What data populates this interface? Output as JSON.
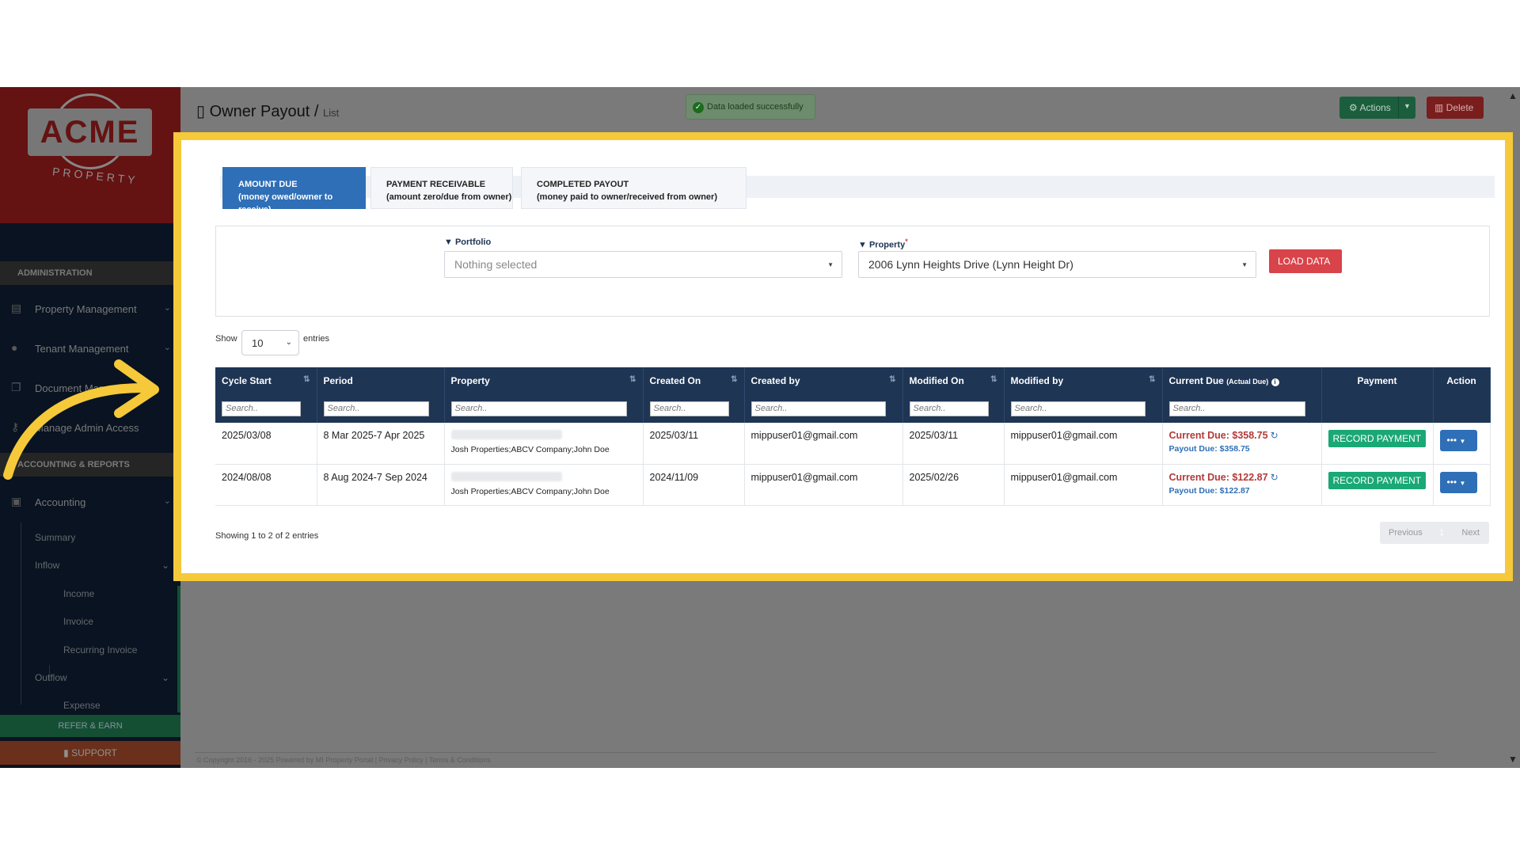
{
  "brand": {
    "logo_text": "ACME",
    "logo_sub": "PROPERTY"
  },
  "sidebar": {
    "sections": {
      "admin": "ADMINISTRATION",
      "accounting": "ACCOUNTING & REPORTS"
    },
    "items": [
      {
        "label": "Property Management",
        "icon": "building-icon"
      },
      {
        "label": "Tenant Management",
        "icon": "users-icon"
      },
      {
        "label": "Document Management",
        "icon": "copy-icon"
      },
      {
        "label": "Manage Admin Access",
        "icon": "key-icon"
      },
      {
        "label": "Accounting",
        "icon": "money-icon"
      }
    ],
    "subitems": {
      "summary": "Summary",
      "inflow": "Inflow",
      "income": "Income",
      "invoice": "Invoice",
      "recurring": "Recurring Invoice",
      "outflow": "Outflow",
      "expense": "Expense"
    },
    "refer": "REFER & EARN",
    "support": "SUPPORT"
  },
  "header": {
    "title": "Owner Payout",
    "separator": "/",
    "crumb": "List",
    "toast": "Data loaded successfully",
    "actions_label": "Actions",
    "delete_label": "Delete"
  },
  "tabs": [
    {
      "title": "AMOUNT DUE",
      "subtitle": "(money owed/owner to receive)",
      "active": true
    },
    {
      "title": "PAYMENT RECEIVABLE",
      "subtitle": "(amount zero/due from owner)",
      "active": false
    },
    {
      "title": "COMPLETED PAYOUT",
      "subtitle": "(money paid to owner/received from owner)",
      "active": false
    }
  ],
  "filters": {
    "portfolio_label": "Portfolio",
    "portfolio_value": "Nothing selected",
    "property_label": "Property",
    "property_required": "*",
    "property_value": "2006 Lynn Heights Drive (Lynn Height Dr)",
    "load_button": "LOAD DATA"
  },
  "entries": {
    "show": "Show",
    "value": "10",
    "suffix": "entries"
  },
  "table": {
    "columns": [
      "Cycle Start",
      "Period",
      "Property",
      "Created On",
      "Created by",
      "Modified On",
      "Modified by",
      "Current Due",
      "Payment",
      "Action"
    ],
    "current_due_note": "(Actual Due)",
    "search_placeholder": "Search..",
    "rows": [
      {
        "cycle_start": "2025/03/08",
        "period": "8 Mar 2025-7 Apr 2025",
        "property_sub": "Josh Properties;ABCV Company;John Doe",
        "created_on": "2025/03/11",
        "created_by": "mippuser01@gmail.com",
        "modified_on": "2025/03/11",
        "modified_by": "mippuser01@gmail.com",
        "current_due": "Current Due: $358.75",
        "payout_due": "Payout Due: $358.75",
        "payment_button": "RECORD PAYMENT"
      },
      {
        "cycle_start": "2024/08/08",
        "period": "8 Aug 2024-7 Sep 2024",
        "property_sub": "Josh Properties;ABCV Company;John Doe",
        "created_on": "2024/11/09",
        "created_by": "mippuser01@gmail.com",
        "modified_on": "2025/02/26",
        "modified_by": "mippuser01@gmail.com",
        "current_due": "Current Due: $122.87",
        "payout_due": "Payout Due: $122.87",
        "payment_button": "RECORD PAYMENT"
      }
    ]
  },
  "pagination": {
    "showing": "Showing 1 to 2 of 2 entries",
    "previous": "Previous",
    "page": "1",
    "next": "Next"
  },
  "footer": {
    "text": "© Copyright 2016 - 2025 Powered by MI Property Portal | Privacy Policy | Terms & Conditions"
  },
  "colors": {
    "highlight": "#f5c93a",
    "header_navy": "#1e3554",
    "tab_active": "#2f6fb7",
    "load_red": "#d9434a",
    "record_green": "#1aa877",
    "due_red": "#b33a3a"
  }
}
